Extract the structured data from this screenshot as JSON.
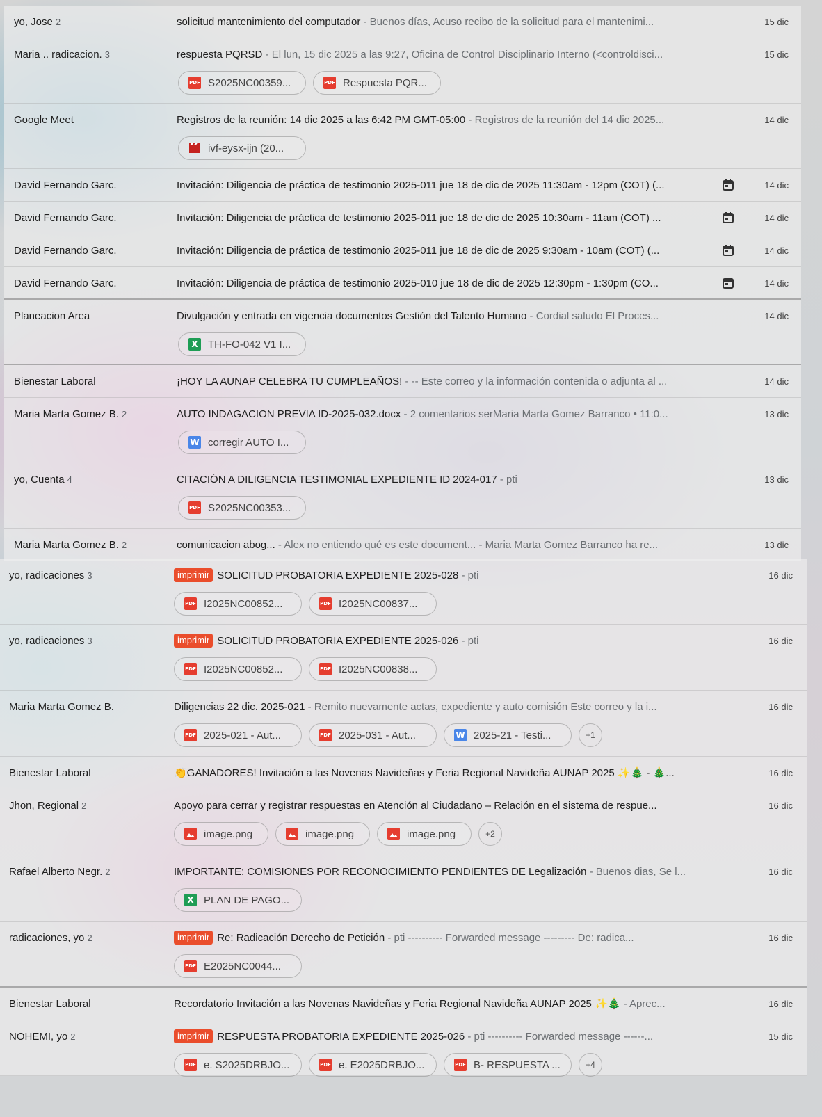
{
  "top_rows": [
    {
      "sender": "yo, Jose",
      "count": "2",
      "label": "",
      "subject": "solicitud mantenimiento del computador",
      "snippet": "Buenos días, Acuso recibo de la solicitud para el mantenimi...",
      "date": "15 dic",
      "calendar": false,
      "attachments": []
    },
    {
      "sender": "Maria .. radicacion.",
      "count": "3",
      "label": "",
      "subject": "respuesta PQRSD",
      "snippet": "El lun, 15 dic 2025 a las 9:27, Oficina de Control Disciplinario Interno (<controldisci...",
      "date": "15 dic",
      "calendar": false,
      "attachments": [
        {
          "icon": "pdf",
          "name": "S2025NC00359..."
        },
        {
          "icon": "pdf",
          "name": "Respuesta PQR..."
        }
      ]
    },
    {
      "sender": "Google Meet",
      "count": "",
      "label": "",
      "subject": "Registros de la reunión: 14 dic 2025 a las 6:42 PM GMT-05:00",
      "snippet": "Registros de la reunión del 14 dic 2025...",
      "date": "14 dic",
      "calendar": false,
      "attachments": [
        {
          "icon": "vid",
          "name": "ivf-eysx-ijn (20..."
        }
      ]
    },
    {
      "sender": "David Fernando Garc.",
      "count": "",
      "label": "",
      "subject": "Invitación: Diligencia de práctica de testimonio 2025-011 jue 18 de dic de 2025 11:30am - 12pm (COT) (...",
      "snippet": "",
      "date": "14 dic",
      "calendar": true,
      "attachments": []
    },
    {
      "sender": "David Fernando Garc.",
      "count": "",
      "label": "",
      "subject": "Invitación: Diligencia de práctica de testimonio 2025-011 jue 18 de dic de 2025 10:30am - 11am (COT) ...",
      "snippet": "",
      "date": "14 dic",
      "calendar": true,
      "attachments": []
    },
    {
      "sender": "David Fernando Garc.",
      "count": "",
      "label": "",
      "subject": "Invitación: Diligencia de práctica de testimonio 2025-011 jue 18 de dic de 2025 9:30am - 10am (COT) (...",
      "snippet": "",
      "date": "14 dic",
      "calendar": true,
      "attachments": []
    },
    {
      "sender": "David Fernando Garc.",
      "count": "",
      "label": "",
      "subject": "Invitación: Diligencia de práctica de testimonio 2025-010 jue 18 de dic de 2025 12:30pm - 1:30pm (CO...",
      "snippet": "",
      "date": "14 dic",
      "calendar": true,
      "attachments": []
    },
    {
      "sender": "Planeacion Area",
      "count": "",
      "label": "",
      "subject": "Divulgación y entrada en vigencia documentos Gestión del Talento Humano",
      "snippet": "Cordial saludo El Proces...",
      "date": "14 dic",
      "calendar": false,
      "attachments": [
        {
          "icon": "xls",
          "name": "TH-FO-042 V1 I..."
        }
      ]
    },
    {
      "sender": "Bienestar Laboral",
      "count": "",
      "label": "",
      "subject": "¡HOY LA AUNAP CELEBRA TU CUMPLEAÑOS!",
      "snippet": "-- Este correo y la información contenida o adjunta al ...",
      "date": "14 dic",
      "calendar": false,
      "attachments": []
    },
    {
      "sender": "Maria Marta Gomez B.",
      "count": "2",
      "label": "",
      "subject": "AUTO INDAGACION PREVIA ID-2025-032.docx",
      "snippet": "2 comentarios serMaria Marta Gomez Barranco • 11:0...",
      "date": "13 dic",
      "calendar": false,
      "attachments": [
        {
          "icon": "doc",
          "name": "corregir AUTO I..."
        }
      ]
    },
    {
      "sender": "yo, Cuenta",
      "count": "4",
      "label": "",
      "subject": "CITACIÓN A DILIGENCIA TESTIMONIAL EXPEDIENTE ID 2024-017",
      "snippet": "pti",
      "date": "13 dic",
      "calendar": false,
      "attachments": [
        {
          "icon": "pdf",
          "name": "S2025NC00353..."
        }
      ]
    },
    {
      "sender": "Maria Marta Gomez B.",
      "count": "2",
      "label": "",
      "subject": "comunicacion abog...",
      "snippet": "Alex no entiendo qué es este document... - Maria Marta Gomez Barranco ha re...",
      "date": "13 dic",
      "calendar": false,
      "attachments": []
    }
  ],
  "bottom_rows": [
    {
      "sender": "yo, radicaciones",
      "count": "3",
      "label": "imprimir",
      "subject": "SOLICITUD PROBATORIA EXPEDIENTE 2025-028",
      "snippet": "pti",
      "date": "16 dic",
      "attachments": [
        {
          "icon": "pdf",
          "name": "I2025NC00852..."
        },
        {
          "icon": "pdf",
          "name": "I2025NC00837..."
        }
      ],
      "more": ""
    },
    {
      "sender": "yo, radicaciones",
      "count": "3",
      "label": "imprimir",
      "subject": "SOLICITUD PROBATORIA EXPEDIENTE 2025-026",
      "snippet": "pti",
      "date": "16 dic",
      "attachments": [
        {
          "icon": "pdf",
          "name": "I2025NC00852..."
        },
        {
          "icon": "pdf",
          "name": "I2025NC00838..."
        }
      ],
      "more": ""
    },
    {
      "sender": "Maria Marta Gomez B.",
      "count": "",
      "label": "",
      "subject": "Diligencias 22 dic. 2025-021",
      "snippet": "Remito nuevamente actas, expediente y auto comisión Este correo y la i...",
      "date": "16 dic",
      "attachments": [
        {
          "icon": "pdf",
          "name": "2025-021 - Aut..."
        },
        {
          "icon": "pdf",
          "name": "2025-031 - Aut..."
        },
        {
          "icon": "doc",
          "name": "2025-21 - Testi..."
        }
      ],
      "more": "+1"
    },
    {
      "sender": "Bienestar Laboral",
      "count": "",
      "label": "",
      "subject": "👏GANADORES! Invitación a las Novenas Navideñas y Feria Regional Navideña AUNAP 2025 ✨🎄 - 🎄...",
      "snippet": "",
      "date": "16 dic",
      "attachments": [],
      "more": ""
    },
    {
      "sender": "Jhon, Regional",
      "count": "2",
      "label": "",
      "subject": "Apoyo para cerrar y registrar respuestas en Atención al Ciudadano – Relación en el sistema de respue...",
      "snippet": "",
      "date": "16 dic",
      "attachments": [
        {
          "icon": "image",
          "name": "image.png"
        },
        {
          "icon": "image",
          "name": "image.png"
        },
        {
          "icon": "image",
          "name": "image.png"
        }
      ],
      "more": "+2"
    },
    {
      "sender": "Rafael Alberto Negr.",
      "count": "2",
      "label": "",
      "subject": "IMPORTANTE: COMISIONES POR RECONOCIMIENTO PENDIENTES DE Legalización",
      "snippet": "Buenos dias, Se l...",
      "date": "16 dic",
      "attachments": [
        {
          "icon": "xls",
          "name": "PLAN DE PAGO..."
        }
      ],
      "more": ""
    },
    {
      "sender": "radicaciones, yo",
      "count": "2",
      "label": "imprimir",
      "subject": "Re: Radicación Derecho de Petición",
      "snippet": "pti ---------- Forwarded message --------- De: radica...",
      "date": "16 dic",
      "attachments": [
        {
          "icon": "pdf",
          "name": "E2025NC0044..."
        }
      ],
      "more": ""
    },
    {
      "sender": "Bienestar Laboral",
      "count": "",
      "label": "",
      "subject": "Recordatorio Invitación a las Novenas Navideñas y Feria Regional Navideña AUNAP 2025 ✨🎄",
      "snippet": "Aprec...",
      "date": "16 dic",
      "attachments": [],
      "more": ""
    },
    {
      "sender": "NOHEMI, yo",
      "count": "2",
      "label": "imprimir",
      "subject": "RESPUESTA PROBATORIA EXPEDIENTE 2025-026",
      "snippet": "pti ---------- Forwarded message ------...",
      "date": "15 dic",
      "attachments": [
        {
          "icon": "pdf",
          "name": "e. S2025DRBJO..."
        },
        {
          "icon": "pdf",
          "name": "e. E2025DRBJO..."
        },
        {
          "icon": "pdf",
          "name": "B- RESPUESTA ..."
        }
      ],
      "more": "+4"
    }
  ],
  "icons": {
    "pdf": "pdf-icon",
    "xls": "sheets-icon",
    "doc": "docs-icon",
    "vid": "video-icon",
    "image": "image-icon"
  },
  "colors": {
    "label_bg": "#ea4d2c",
    "pdf": "#e53d2f",
    "sheets": "#1f9d55",
    "docs": "#4a86e8"
  }
}
